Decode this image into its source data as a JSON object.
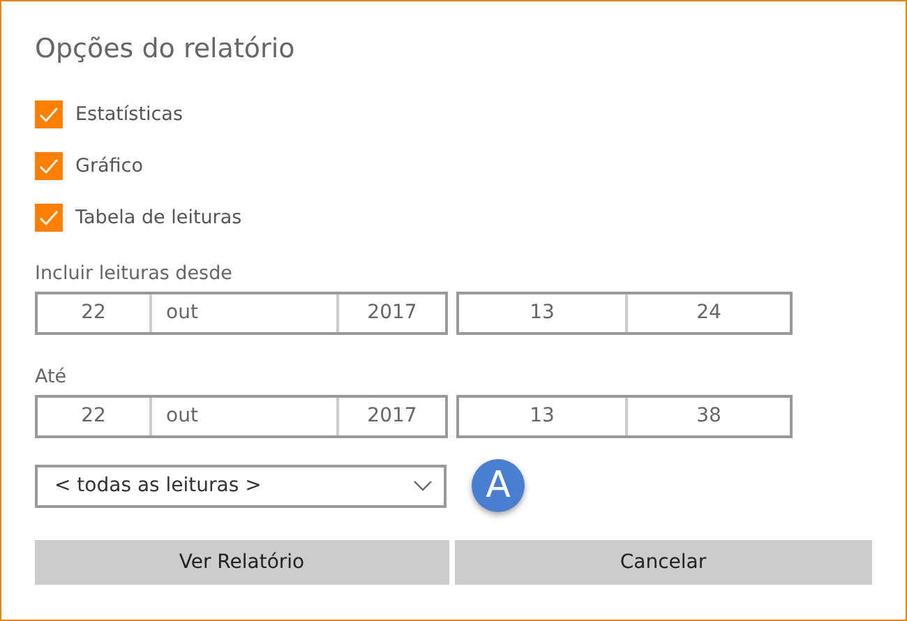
{
  "title": "Opções do relatório",
  "options": [
    {
      "label": "Estatísticas",
      "checked": true
    },
    {
      "label": "Gráfico",
      "checked": true
    },
    {
      "label": "Tabela de leituras",
      "checked": true
    }
  ],
  "ranges": [
    {
      "label": "Incluir leituras desde",
      "day": "22",
      "month": "out",
      "year": "2017",
      "hour": "13",
      "minute": "24"
    },
    {
      "label": "Até",
      "day": "22",
      "month": "out",
      "year": "2017",
      "hour": "13",
      "minute": "38"
    }
  ],
  "filter": {
    "value": "< todas as leituras >",
    "badge": "A"
  },
  "buttons": [
    "Ver Relatório",
    "Cancelar"
  ]
}
